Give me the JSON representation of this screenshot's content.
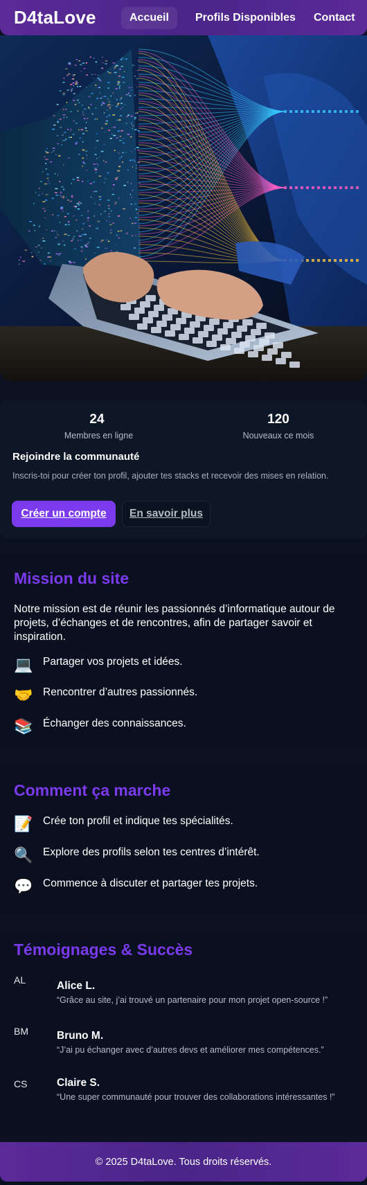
{
  "nav": {
    "brand": "D4taLove",
    "links": [
      {
        "label": "Accueil",
        "active": true
      },
      {
        "label": "Profils Disponibles",
        "active": false
      },
      {
        "label": "Contact",
        "active": false
      }
    ]
  },
  "hero": {
    "image_icon": "laptop-data-streams-image"
  },
  "stats": [
    {
      "value": "24",
      "label": "Membres en ligne"
    },
    {
      "value": "120",
      "label": "Nouveaux ce mois"
    }
  ],
  "join": {
    "title": "Rejoindre la communauté",
    "description": "Inscris-toi pour créer ton profil, ajouter tes stacks et recevoir des mises en relation.",
    "primary_button": "Créer un compte",
    "secondary_button": "En savoir plus"
  },
  "mission": {
    "title": "Mission du site",
    "text": "Notre mission est de réunir les passionnés d’informatique autour de projets, d’échanges et de rencontres, afin de partager savoir et inspiration.",
    "items": [
      {
        "icon": "💻",
        "text": "Partager vos projets et idées."
      },
      {
        "icon": "🤝",
        "text": "Rencontrer d’autres passionnés."
      },
      {
        "icon": "📚",
        "text": "Échanger des connaissances."
      }
    ]
  },
  "how": {
    "title": "Comment ça marche",
    "items": [
      {
        "icon": "📝",
        "text": "Crée ton profil et indique tes spécialités."
      },
      {
        "icon": "🔍",
        "text": "Explore des profils selon tes centres d’intérêt."
      },
      {
        "icon": "💬",
        "text": "Commence à discuter et partager tes projets."
      }
    ]
  },
  "testimonials": {
    "title": "Témoignages & Succès",
    "items": [
      {
        "initials": "AL",
        "name": "Alice L.",
        "quote": "“Grâce au site, j’ai trouvé un partenaire pour mon projet open-source !”"
      },
      {
        "initials": "BM",
        "name": "Bruno M.",
        "quote": "“J’ai pu échanger avec d’autres devs et améliorer mes compétences.”"
      },
      {
        "initials": "CS",
        "name": "Claire S.",
        "quote": "“Une super communauté pour trouver des collaborations intéressantes !”"
      }
    ]
  },
  "footer": {
    "text": "© 2025 D4taLove. Tous droits réservés."
  },
  "colors": {
    "accent": "#7c3aed",
    "nav_bg": "#4a2588",
    "page_bg": "#0b1120"
  }
}
